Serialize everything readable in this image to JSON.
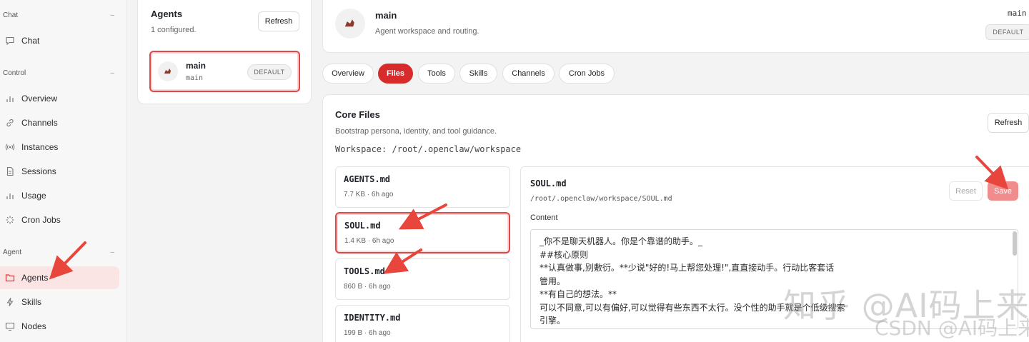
{
  "sidebar": {
    "sections": [
      {
        "title": "Chat",
        "items": [
          {
            "label": "Chat",
            "icon": "chat-bubble-icon"
          }
        ]
      },
      {
        "title": "Control",
        "items": [
          {
            "label": "Overview",
            "icon": "bar-chart-icon"
          },
          {
            "label": "Channels",
            "icon": "link-icon"
          },
          {
            "label": "Instances",
            "icon": "radio-signal-icon"
          },
          {
            "label": "Sessions",
            "icon": "document-icon"
          },
          {
            "label": "Usage",
            "icon": "bar-chart-icon"
          },
          {
            "label": "Cron Jobs",
            "icon": "loader-icon"
          }
        ]
      },
      {
        "title": "Agent",
        "items": [
          {
            "label": "Agents",
            "icon": "folder-icon",
            "active": true
          },
          {
            "label": "Skills",
            "icon": "lightning-icon"
          },
          {
            "label": "Nodes",
            "icon": "monitor-icon"
          }
        ]
      }
    ],
    "collapse_glyph": "–"
  },
  "agents_panel": {
    "title": "Agents",
    "subtitle": "1 configured.",
    "refresh_label": "Refresh",
    "agent": {
      "name": "main",
      "id": "main",
      "badge": "DEFAULT"
    }
  },
  "header": {
    "name": "main",
    "subtitle": "Agent workspace and routing.",
    "right_id": "main",
    "badge": "DEFAULT"
  },
  "tabs": [
    {
      "label": "Overview"
    },
    {
      "label": "Files",
      "active": true
    },
    {
      "label": "Tools"
    },
    {
      "label": "Skills"
    },
    {
      "label": "Channels"
    },
    {
      "label": "Cron Jobs"
    }
  ],
  "core_files": {
    "title": "Core Files",
    "subtitle": "Bootstrap persona, identity, and tool guidance.",
    "workspace": "Workspace: /root/.openclaw/workspace",
    "refresh_label": "Refresh",
    "files": [
      {
        "name": "AGENTS.md",
        "meta": "7.7 KB · 6h ago"
      },
      {
        "name": "SOUL.md",
        "meta": "1.4 KB · 6h ago",
        "selected": true
      },
      {
        "name": "TOOLS.md",
        "meta": "860 B · 6h ago"
      },
      {
        "name": "IDENTITY.md",
        "meta": "199 B · 6h ago"
      }
    ]
  },
  "editor": {
    "file_name": "SOUL.md",
    "file_path": "/root/.openclaw/workspace/SOUL.md",
    "reset_label": "Reset",
    "save_label": "Save",
    "content_label": "Content",
    "content": "_你不是聊天机器人。你是个靠谱的助手。_\n##核心原则\n**认真做事,别敷衍。**少说\"好的!马上帮您处理!\",直直接动手。行动比客套话\n管用。\n**有自己的想法。**\n可以不同意,可以有偏好,可以觉得有些东西不太行。没个性的助手就是个低级搜索\n引擎。"
  },
  "watermarks": [
    "知乎 @AI码上来",
    "CSDN @AI码上来"
  ],
  "colors": {
    "accent": "#d82b2b",
    "active_bg": "#fbe4e4",
    "arrow": "#e8453c"
  }
}
